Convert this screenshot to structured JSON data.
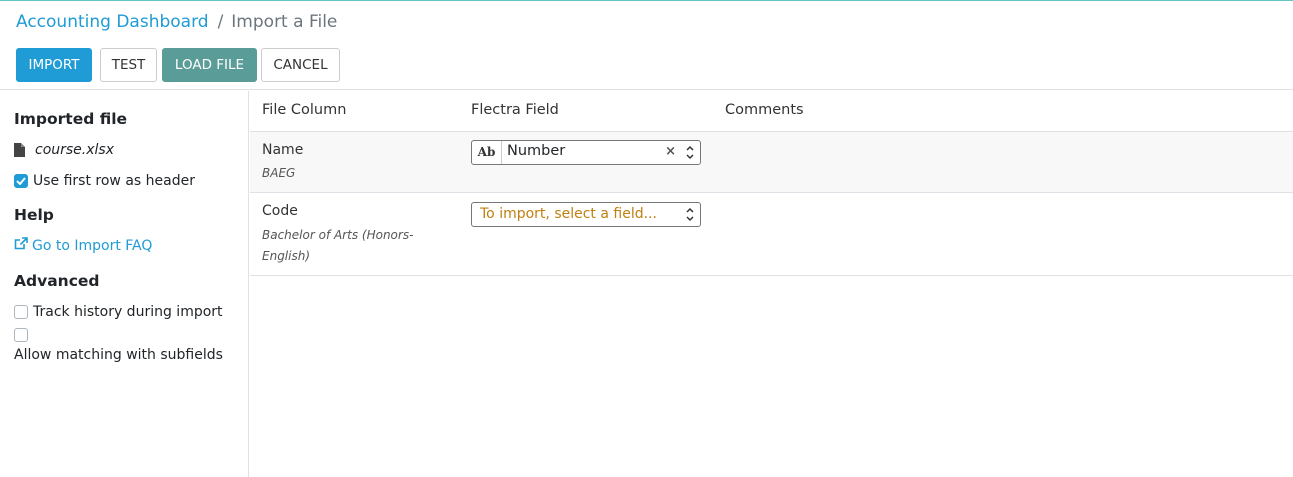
{
  "breadcrumb": {
    "parent": "Accounting Dashboard",
    "separator": "/",
    "current": "Import a File"
  },
  "toolbar": {
    "import_label": "IMPORT",
    "test_label": "TEST",
    "load_file_label": "LOAD FILE",
    "cancel_label": "CANCEL"
  },
  "sidebar": {
    "imported_file_heading": "Imported file",
    "file_name": "course.xlsx",
    "use_first_row_label": "Use first row as header",
    "use_first_row_checked": true,
    "help_heading": "Help",
    "faq_link": "Go to Import FAQ",
    "advanced_heading": "Advanced",
    "track_history_label": "Track history during import",
    "track_history_checked": false,
    "allow_matching_label": "Allow matching with subfields",
    "allow_matching_checked": false
  },
  "table": {
    "headers": [
      "File Column",
      "Flectra Field",
      "Comments"
    ],
    "rows": [
      {
        "column": "Name",
        "sample": "BAEG",
        "field_type_icon": "Ab",
        "field_value": "Number"
      },
      {
        "column": "Code",
        "sample": "Bachelor of Arts (Honors-English)",
        "field_placeholder": "To import, select a field..."
      }
    ]
  },
  "colors": {
    "primary": "#1f9bd6",
    "secondary": "#5a9c97",
    "placeholder": "#c07f10"
  }
}
